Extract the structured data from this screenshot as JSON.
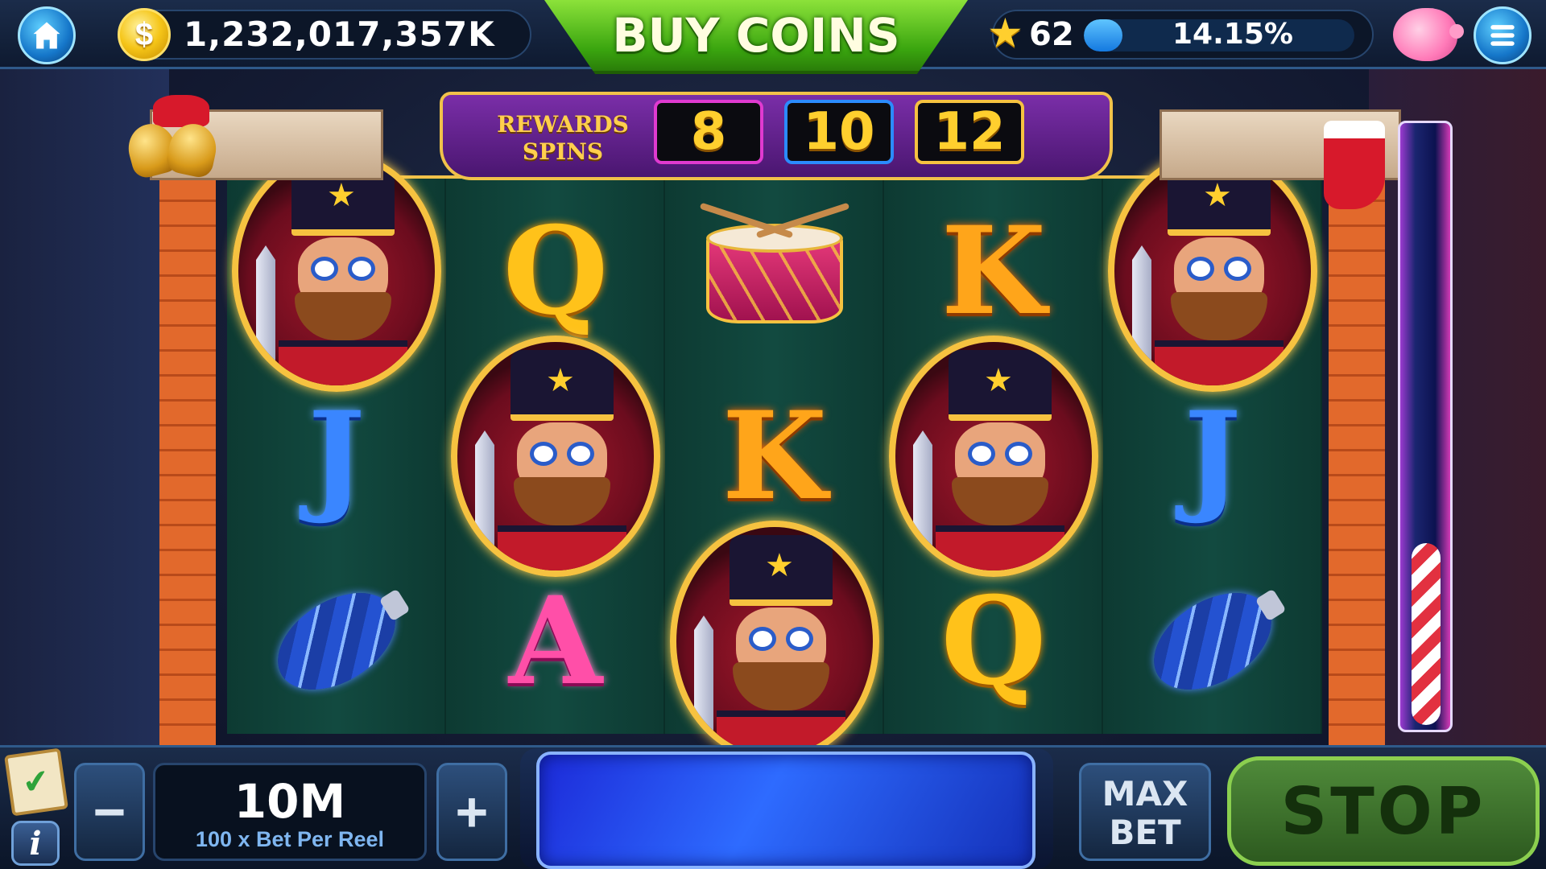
{
  "top_bar": {
    "coins": "1,232,017,357K",
    "coin_symbol": "$",
    "buy_coins_label": "BUY COINS",
    "level": "62",
    "xp_percent_text": "14.15%",
    "xp_progress": 0.1415
  },
  "rewards": {
    "label_line1": "REWARDS",
    "label_line2": "SPINS",
    "options": [
      "8",
      "10",
      "12"
    ]
  },
  "reels": [
    [
      "nutcracker",
      "J",
      "ornament"
    ],
    [
      "Q",
      "nutcracker",
      "A"
    ],
    [
      "drum",
      "K",
      "nutcracker"
    ],
    [
      "K",
      "nutcracker",
      "Q"
    ],
    [
      "nutcracker",
      "J",
      "ornament"
    ]
  ],
  "meter": {
    "progress": 0.3
  },
  "bottom_bar": {
    "minus_label": "−",
    "plus_label": "+",
    "bet_value": "10M",
    "bet_sub": "100 x Bet Per Reel",
    "info_label": "i",
    "max_bet_line1": "MAX",
    "max_bet_line2": "BET",
    "stop_label": "STOP"
  },
  "colors": {
    "reel_bg": "#0f3d35",
    "gold_trim": "#f1c24a",
    "spin_button": "#2e6bff",
    "stop_button": "#4f8a3a"
  }
}
